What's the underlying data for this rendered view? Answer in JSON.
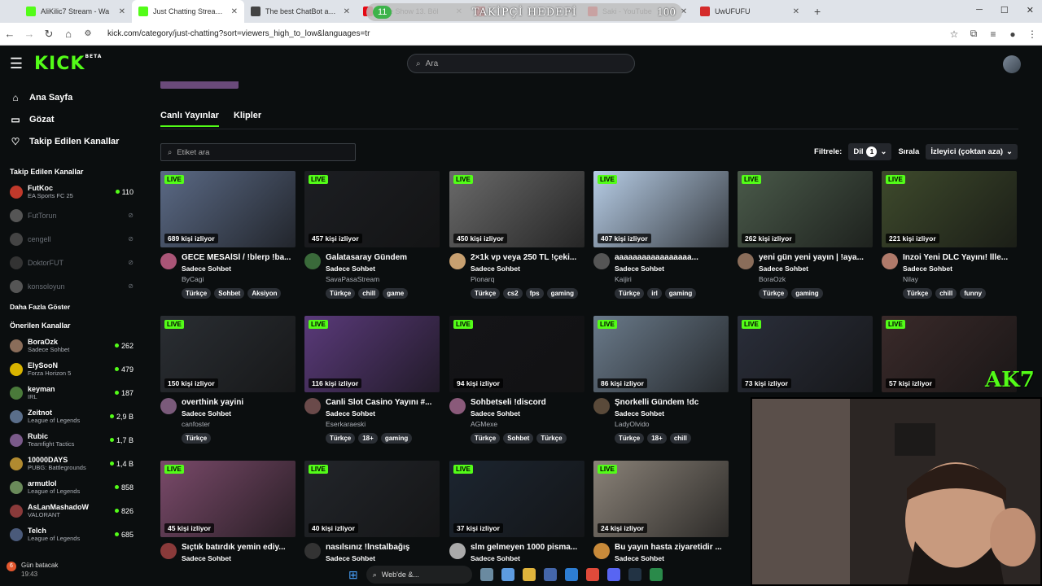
{
  "browser": {
    "tabs": [
      {
        "title": "AliKilic7 Stream - Wa",
        "color": "#53fc18"
      },
      {
        "title": "Just Chatting Streaming",
        "color": "#53fc18"
      },
      {
        "title": "The best ChatBot and W",
        "color": "#444444"
      },
      {
        "title": "Date Show 13. Böl",
        "color": "#e50914"
      },
      {
        "title": "",
        "color": "#e50914"
      },
      {
        "title": "Saki - YouTube",
        "color": "#ff0000"
      },
      {
        "title": "UwUFUFU",
        "color": "#d42b2b"
      }
    ],
    "url": "kick.com/category/just-chatting?sort=viewers_high_to_low&languages=tr",
    "overlay": {
      "left": "11",
      "label": "TAKİPÇİ HEDEFİ",
      "right": "100"
    }
  },
  "header": {
    "logo": "KICK",
    "logo_sup": "BETA",
    "search_placeholder": "Ara"
  },
  "sidebar": {
    "nav": [
      {
        "label": "Ana Sayfa",
        "icon": "home-icon"
      },
      {
        "label": "Gözat",
        "icon": "browse-icon"
      },
      {
        "label": "Takip Edilen Kanallar",
        "icon": "heart-icon"
      }
    ],
    "followed_heading": "Takip Edilen Kanallar",
    "followed": [
      {
        "name": "FutKoc",
        "category": "EA Sports FC 25",
        "viewers": "110",
        "live": true,
        "color": "#c0392b"
      },
      {
        "name": "FutTorun",
        "category": "",
        "viewers": "",
        "live": false,
        "color": "#555555"
      },
      {
        "name": "cengell",
        "category": "",
        "viewers": "",
        "live": false,
        "color": "#444444"
      },
      {
        "name": "DoktorFUT",
        "category": "",
        "viewers": "",
        "live": false,
        "color": "#333333"
      },
      {
        "name": "konsoloyun",
        "category": "",
        "viewers": "",
        "live": false,
        "color": "#555555"
      }
    ],
    "show_more": "Daha Fazla Göster",
    "recommended_heading": "Önerilen Kanallar",
    "recommended": [
      {
        "name": "BoraOzk",
        "category": "Sadece Sohbet",
        "viewers": "262",
        "color": "#8a6d5a"
      },
      {
        "name": "ElySooN",
        "category": "Forza Horizon 5",
        "viewers": "479",
        "color": "#d9b400"
      },
      {
        "name": "keyman",
        "category": "IRL",
        "viewers": "187",
        "color": "#4a7a3a"
      },
      {
        "name": "Zeitnot",
        "category": "League of Legends",
        "viewers": "2,9 B",
        "color": "#5a6e8a"
      },
      {
        "name": "Rubic",
        "category": "Teamfight Tactics",
        "viewers": "1,7 B",
        "color": "#7a5a8a"
      },
      {
        "name": "10000DAYS",
        "category": "PUBG: Battlegrounds",
        "viewers": "1,4 B",
        "color": "#b08a30"
      },
      {
        "name": "armutlol",
        "category": "League of Legends",
        "viewers": "858",
        "color": "#6a8a5a"
      },
      {
        "name": "AsLanMashadoW",
        "category": "VALORANT",
        "viewers": "826",
        "color": "#8a3a3a"
      },
      {
        "name": "Telch",
        "category": "League of Legends",
        "viewers": "685",
        "color": "#4a5a7a"
      }
    ]
  },
  "notification": {
    "badge": "6",
    "text": "Gün batacak",
    "time": "19:43"
  },
  "main": {
    "tabs": [
      "Canlı Yayınlar",
      "Klipler"
    ],
    "tag_search_placeholder": "Etiket ara",
    "filter_label": "Filtrele:",
    "lang_label": "Dil",
    "lang_count": "1",
    "sort_label": "Sırala",
    "sort_value": "İzleyici (çoktan aza)",
    "live_label": "LIVE",
    "cards": [
      {
        "viewers": "689 kişi izliyor",
        "title": "GECE MESAİSİ / !blerp !ba...",
        "category": "Sadece Sohbet",
        "user": "ByCagi",
        "tags": [
          "Türkçe",
          "Sohbet",
          "Aksiyon"
        ],
        "thumb": "#5b6a86",
        "avatar": "#aa5577"
      },
      {
        "viewers": "457 kişi izliyor",
        "title": "Galatasaray Gündem",
        "category": "Sadece Sohbet",
        "user": "SavaPasaStream",
        "tags": [
          "Türkçe",
          "chill",
          "game"
        ],
        "thumb": "#1c1e22",
        "avatar": "#3a6a3a"
      },
      {
        "viewers": "450 kişi izliyor",
        "title": "2×1k vp veya 250 TL !çeki...",
        "category": "Sadece Sohbet",
        "user": "Pionarq",
        "tags": [
          "Türkçe",
          "cs2",
          "fps",
          "gaming"
        ],
        "thumb": "#6a6a6a",
        "avatar": "#c8a070"
      },
      {
        "viewers": "407 kişi izliyor",
        "title": "aaaaaaaaaaaaaaaaa...",
        "category": "Sadece Sohbet",
        "user": "Kaijiri",
        "tags": [
          "Türkçe",
          "irl",
          "gaming"
        ],
        "thumb": "#b7cde6",
        "avatar": "#555555"
      },
      {
        "viewers": "262 kişi izliyor",
        "title": "yeni gün yeni yayın | !aya...",
        "category": "Sadece Sohbet",
        "user": "BoraOzk",
        "tags": [
          "Türkçe",
          "gaming"
        ],
        "thumb": "#4a5a4a",
        "avatar": "#8a6d5a"
      },
      {
        "viewers": "221 kişi izliyor",
        "title": "Inzoi Yeni DLC Yayını! İlle...",
        "category": "Sadece Sohbet",
        "user": "Nilay",
        "tags": [
          "Türkçe",
          "chill",
          "funny"
        ],
        "thumb": "#3e4a2c",
        "avatar": "#b07a6a"
      },
      {
        "viewers": "150 kişi izliyor",
        "title": "overthink yayini",
        "category": "Sadece Sohbet",
        "user": "canfoster",
        "tags": [
          "Türkçe"
        ],
        "thumb": "#2a2e33",
        "avatar": "#7a5a7a"
      },
      {
        "viewers": "116 kişi izliyor",
        "title": "Canli Slot Casino Yayını #...",
        "category": "Sadece Sohbet",
        "user": "Eserkaraeski",
        "tags": [
          "Türkçe",
          "18+",
          "gaming"
        ],
        "thumb": "#5a3a7a",
        "avatar": "#6a4a4a"
      },
      {
        "viewers": "94 kişi izliyor",
        "title": "Sohbetseli !discord",
        "category": "Sadece Sohbet",
        "user": "AGMexe",
        "tags": [
          "Türkçe",
          "Sohbet",
          "Türkçe"
        ],
        "thumb": "#141418",
        "avatar": "#8a5a7a"
      },
      {
        "viewers": "86 kişi izliyor",
        "title": "Şnorkelli Gündem !dc",
        "category": "Sadece Sohbet",
        "user": "LadyOlvido",
        "tags": [
          "Türkçe",
          "18+",
          "chill"
        ],
        "thumb": "#6a7a8a",
        "avatar": "#5a4a3a"
      },
      {
        "viewers": "73 kişi izliyor",
        "title": "",
        "category": "",
        "user": "",
        "tags": [],
        "thumb": "#2a2e3a",
        "avatar": "#333333"
      },
      {
        "viewers": "57 kişi izliyor",
        "title": "",
        "category": "",
        "user": "",
        "tags": [],
        "thumb": "#3a2a2a",
        "avatar": "#333333"
      },
      {
        "viewers": "45 kişi izliyor",
        "title": "Sıçtık batırdık yemin ediy...",
        "category": "Sadece Sohbet",
        "user": "",
        "tags": [],
        "thumb": "#7a4a6a",
        "avatar": "#8a3a3a"
      },
      {
        "viewers": "40 kişi izliyor",
        "title": "nasılsınız !İnstalbağış",
        "category": "Sadece Sohbet",
        "user": "",
        "tags": [],
        "thumb": "#22252a",
        "avatar": "#333333"
      },
      {
        "viewers": "37 kişi izliyor",
        "title": "slm gelmeyen 1000 pisma...",
        "category": "Sadece Sohbet",
        "user": "",
        "tags": [],
        "thumb": "#1c2530",
        "avatar": "#aaaaaa"
      },
      {
        "viewers": "24 kişi izliyor",
        "title": "Bu yayın hasta ziyaretidir ...",
        "category": "Sadece Sohbet",
        "user": "",
        "tags": [],
        "thumb": "#8a8278",
        "avatar": "#c88a3a"
      }
    ]
  },
  "overlay_text": "AK7",
  "taskbar": {
    "search_placeholder": "Web'de &..."
  }
}
